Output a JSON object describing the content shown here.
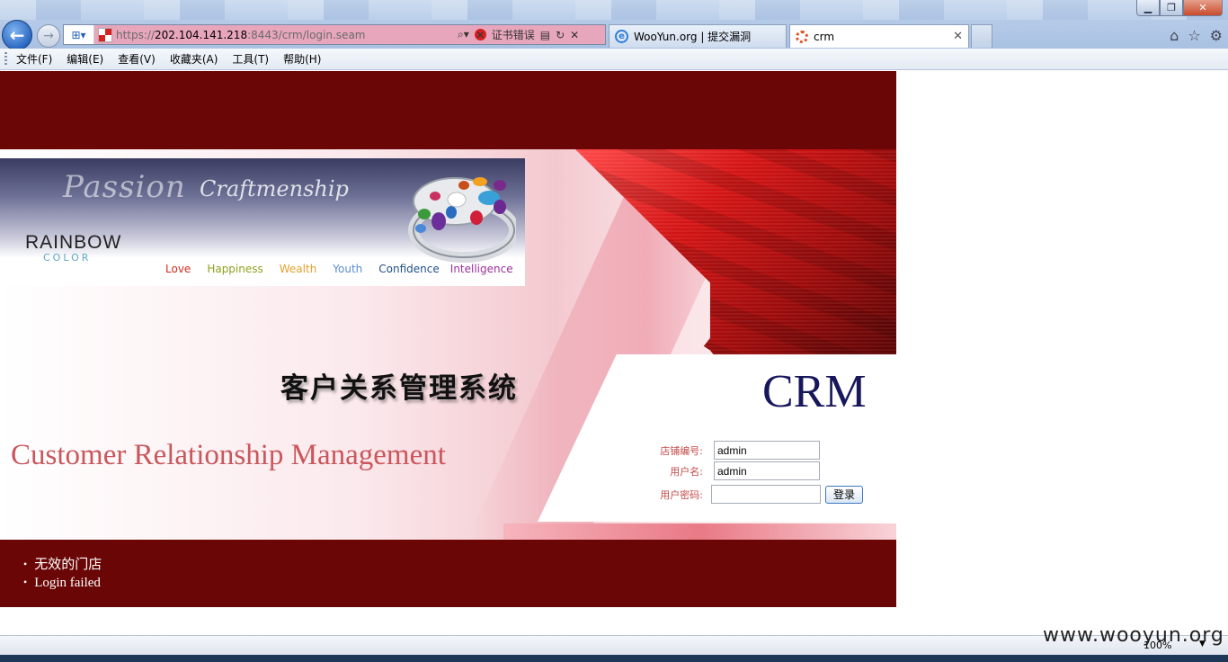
{
  "browser": {
    "url_host_prefix": "https://",
    "url_host": "202.104.141.218",
    "url_rest": ":8443/crm/login.seam",
    "cert_error": "证书错误",
    "tabs": [
      {
        "label": "WooYun.org | 提交漏洞",
        "icon": "ie-icon"
      },
      {
        "label": "crm",
        "icon": "loading-icon"
      }
    ],
    "menu": [
      "文件(F)",
      "编辑(E)",
      "查看(V)",
      "收藏夹(A)",
      "工具(T)",
      "帮助(H)"
    ],
    "zoom": "100%"
  },
  "banner": {
    "script_text_1": "Passion",
    "script_text_2": "Craftmenship",
    "logo_main": "RAINBOW",
    "logo_sub": "COLOR",
    "tags": [
      {
        "label": "Love",
        "color": "#d42b1e"
      },
      {
        "label": "Happiness",
        "color": "#8fa11e"
      },
      {
        "label": "Wealth",
        "color": "#e3a22a"
      },
      {
        "label": "Youth",
        "color": "#5a8ed3"
      },
      {
        "label": "Confidence",
        "color": "#1f4f8a"
      },
      {
        "label": "Intelligence",
        "color": "#9b2f9d"
      }
    ]
  },
  "hero": {
    "title_cn": "客户关系管理系统",
    "title_en": "Customer Relationship Management",
    "crm": "CRM"
  },
  "login": {
    "store_label": "店铺编号:",
    "store_value": "admin",
    "user_label": "用户名:",
    "user_value": "admin",
    "password_label": "用户密码:",
    "password_value": "",
    "submit_label": "登录"
  },
  "messages": [
    "无效的门店",
    "Login failed"
  ],
  "watermark": "www.wooyun.org",
  "colors": {
    "brand_dark_red": "#6b0606",
    "crm_navy": "#17175c",
    "title_en": "#c9575c"
  }
}
